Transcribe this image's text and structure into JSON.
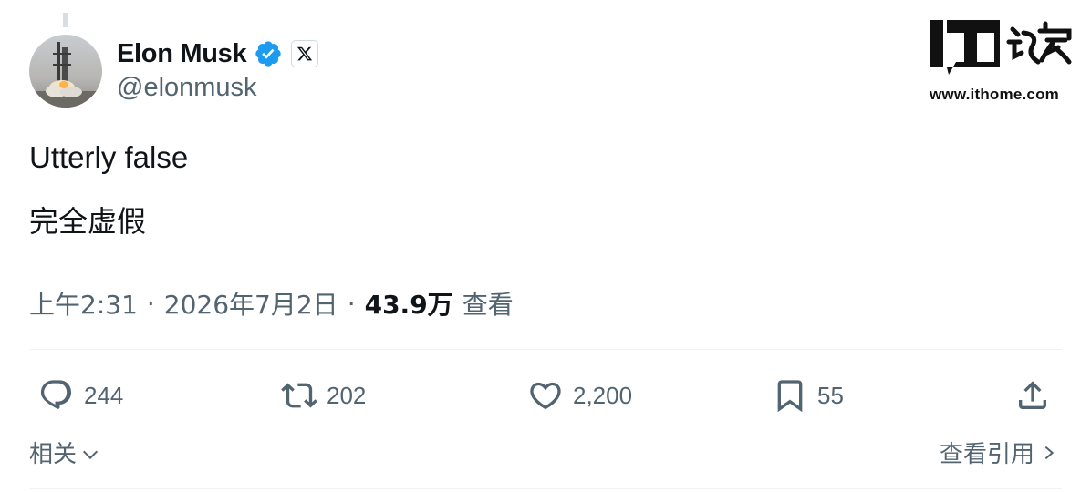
{
  "author": {
    "display_name": "Elon Musk",
    "handle": "@elonmusk",
    "verified_icon": "verified-badge-icon",
    "affiliation_icon": "x-logo-icon",
    "verified_color": "#1d9bf0"
  },
  "tweet": {
    "text": "Utterly false",
    "translation": "完全虚假"
  },
  "meta": {
    "time": "上午2:31",
    "separator": "·",
    "date": "2026年7月2日",
    "views_count": "43.9万",
    "views_label": "查看"
  },
  "actions": {
    "replies": "244",
    "reposts": "202",
    "likes": "2,200",
    "bookmarks": "55"
  },
  "footer": {
    "related_label": "相关",
    "view_quotes_label": "查看引用"
  },
  "watermark": {
    "logo_text": "IT之家",
    "url": "www.ithome.com"
  },
  "colors": {
    "text_primary": "#0f1419",
    "text_secondary": "#536471",
    "divider": "#eff3f4"
  }
}
